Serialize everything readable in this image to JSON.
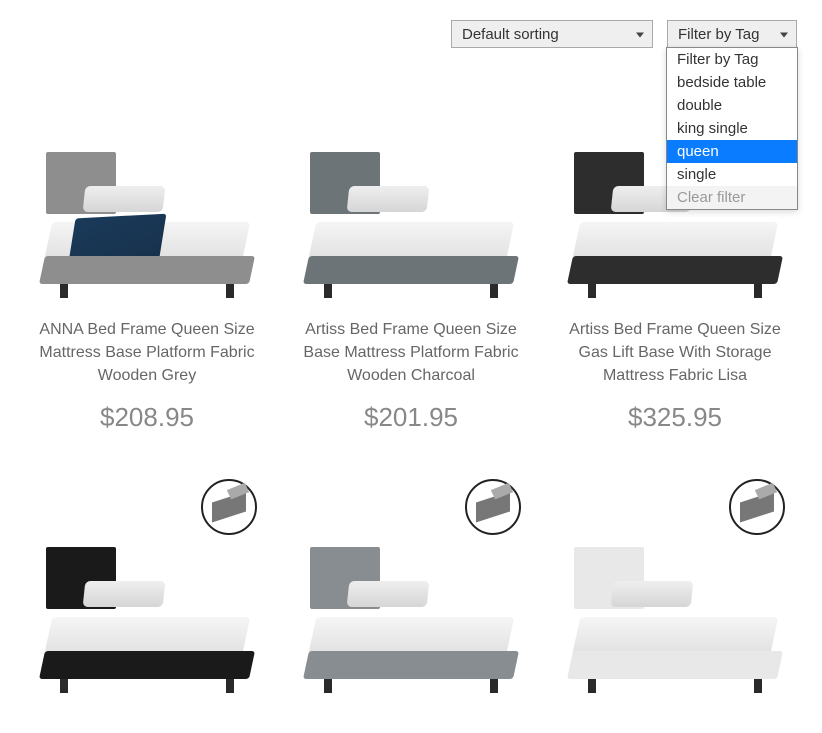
{
  "controls": {
    "sort": {
      "selected": "Default sorting"
    },
    "filter": {
      "selected": "Filter by Tag",
      "options": [
        {
          "label": "Filter by Tag",
          "state": "normal"
        },
        {
          "label": "bedside table",
          "state": "normal"
        },
        {
          "label": "double",
          "state": "normal"
        },
        {
          "label": "king single",
          "state": "normal"
        },
        {
          "label": "queen",
          "state": "highlighted"
        },
        {
          "label": "single",
          "state": "normal"
        },
        {
          "label": "Clear filter",
          "state": "muted"
        }
      ]
    }
  },
  "products": [
    {
      "title": "ANNA Bed Frame Queen Size Mattress Base Platform Fabric Wooden Grey",
      "price": "$208.95",
      "color": "grey-1",
      "throw": true,
      "badge": false
    },
    {
      "title": "Artiss Bed Frame Queen Size Base Mattress Platform Fabric Wooden Charcoal",
      "price": "$201.95",
      "color": "grey-2",
      "throw": false,
      "badge": false
    },
    {
      "title": "Artiss Bed Frame Queen Size Gas Lift Base With Storage Mattress Fabric Lisa",
      "price": "$325.95",
      "color": "dark-1",
      "throw": false,
      "badge": false
    },
    {
      "title": "",
      "price": "",
      "color": "black-1",
      "throw": false,
      "badge": true
    },
    {
      "title": "",
      "price": "",
      "color": "grey-3",
      "throw": false,
      "badge": true
    },
    {
      "title": "",
      "price": "",
      "color": "white-1",
      "throw": false,
      "badge": true
    }
  ]
}
